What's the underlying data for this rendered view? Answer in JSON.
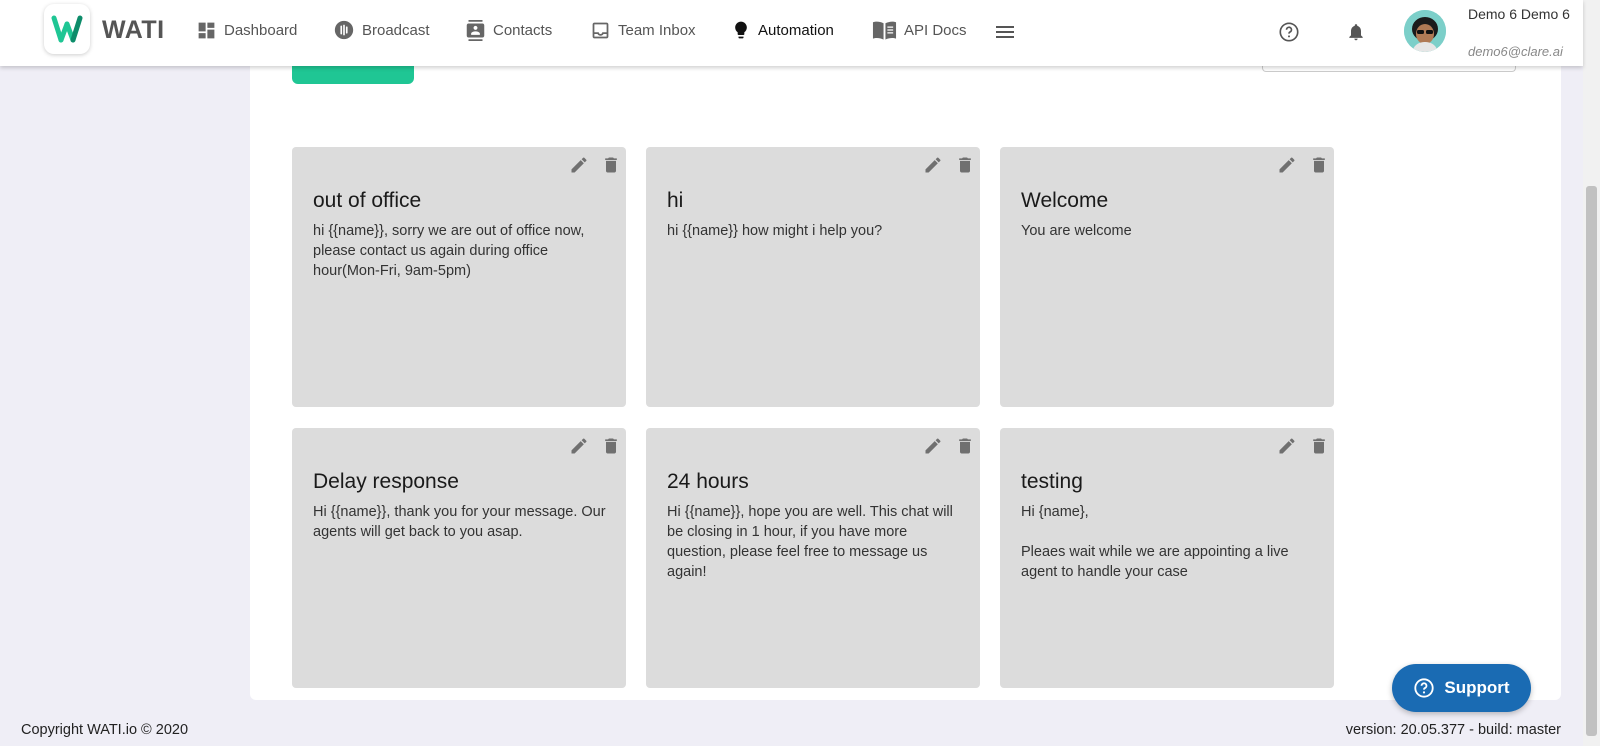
{
  "app": {
    "logo_text": "WATI",
    "brand_color": "#1fc694",
    "support_color": "#1a6bb3"
  },
  "nav": {
    "items": [
      {
        "label": "Dashboard",
        "icon": "dashboard-icon"
      },
      {
        "label": "Broadcast",
        "icon": "broadcast-icon"
      },
      {
        "label": "Contacts",
        "icon": "contacts-icon"
      },
      {
        "label": "Team Inbox",
        "icon": "inbox-icon"
      },
      {
        "label": "Automation",
        "icon": "bulb-icon",
        "active": true
      },
      {
        "label": "API Docs",
        "icon": "book-icon"
      }
    ],
    "menu_icon": "hamburger-icon"
  },
  "user": {
    "name": "Demo 6 Demo 6",
    "email": "demo6@clare.ai"
  },
  "cards": [
    {
      "title": "out of office",
      "body": "hi {{name}}, sorry we are out of office now, please contact us again during office hour(Mon-Fri, 9am-5pm)"
    },
    {
      "title": "hi",
      "body": "hi {{name}} how might i help you?"
    },
    {
      "title": "Welcome",
      "body": "You are welcome"
    },
    {
      "title": "Delay response",
      "body": "Hi {{name}}, thank you for your message. Our agents will get back to you asap."
    },
    {
      "title": "24 hours",
      "body": "Hi {{name}}, hope you are well. This chat will be closing in 1 hour, if you have more question, please feel free to message us again!"
    },
    {
      "title": "testing",
      "body": "Hi {name},\n\nPleaes wait while we are appointing a live agent to handle your case"
    }
  ],
  "footer": {
    "copyright": "Copyright WATI.io © 2020",
    "version": "version: 20.05.377 - build: master"
  },
  "support": {
    "label": "Support"
  }
}
